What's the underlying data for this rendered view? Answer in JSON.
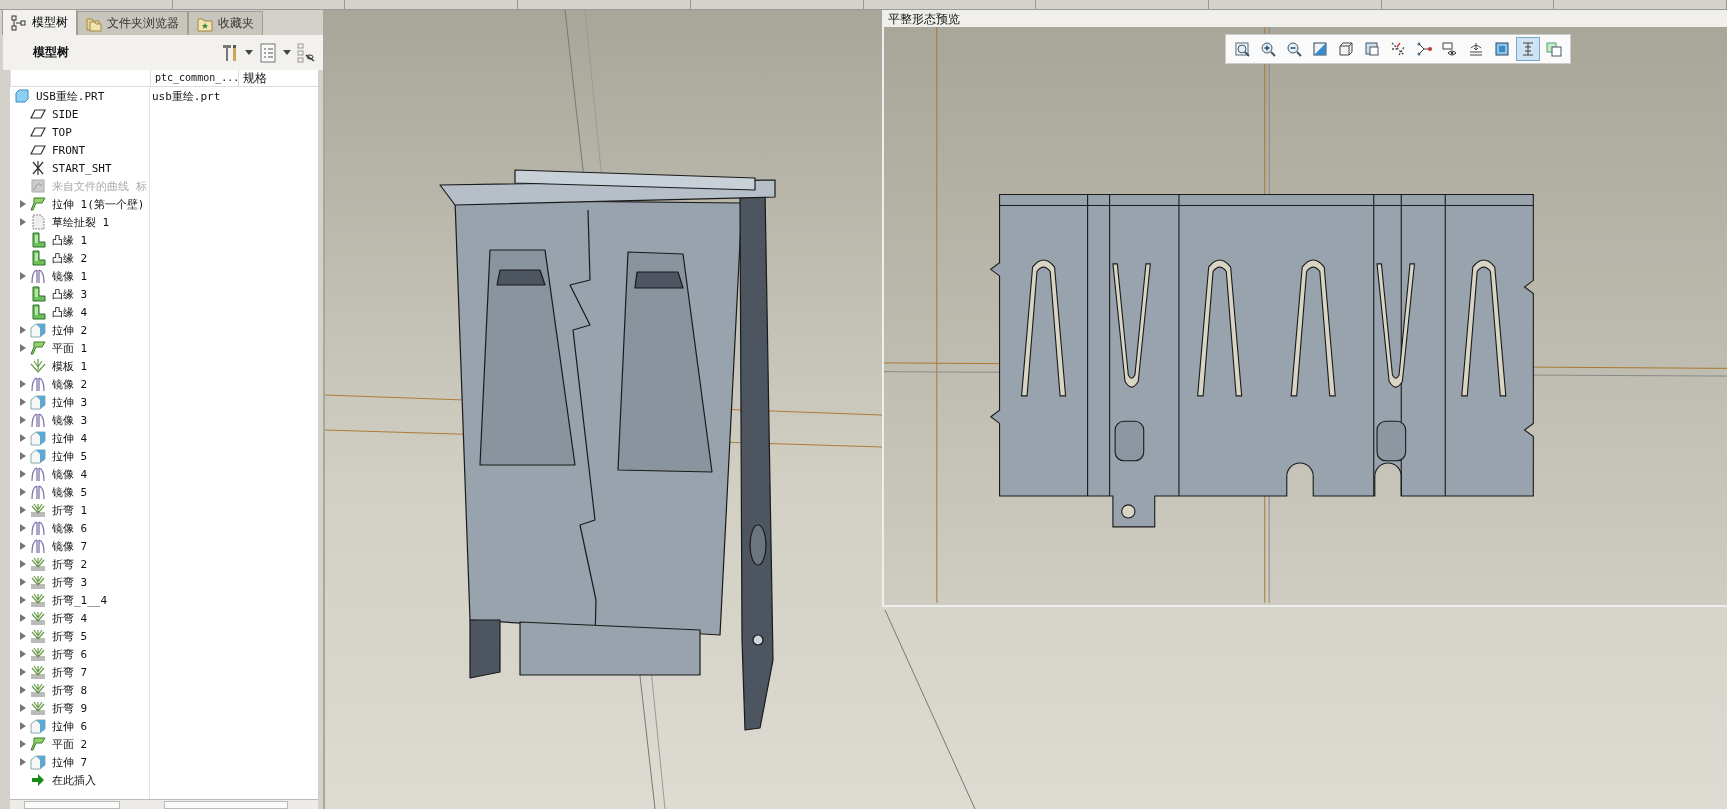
{
  "panel_tabs": [
    {
      "label": "模型树",
      "selected": true
    },
    {
      "label": "文件夹浏览器",
      "selected": false
    },
    {
      "label": "收藏夹",
      "selected": false
    }
  ],
  "model_tree": {
    "title": "模型树",
    "columns": [
      "ptc_common_...",
      "规格"
    ],
    "root": {
      "label": "USB重绘.PRT",
      "cells": [
        "usb重绘.prt"
      ],
      "children": [
        {
          "label": "SIDE",
          "kind": "plane",
          "expander": false,
          "disabled": false
        },
        {
          "label": "TOP",
          "kind": "plane",
          "expander": false,
          "disabled": false
        },
        {
          "label": "FRONT",
          "kind": "plane",
          "expander": false,
          "disabled": false
        },
        {
          "label": "START_SHT",
          "kind": "csys",
          "expander": false,
          "disabled": false
        },
        {
          "label": "来自文件的曲线 标",
          "kind": "curve",
          "expander": false,
          "disabled": true
        },
        {
          "label": "拉伸 1(第一个壁)",
          "kind": "flat",
          "expander": true,
          "disabled": false
        },
        {
          "label": "草绘扯裂 1",
          "kind": "rip",
          "expander": true,
          "disabled": false
        },
        {
          "label": "凸缘 1",
          "kind": "flange",
          "expander": false,
          "disabled": false
        },
        {
          "label": "凸缘 2",
          "kind": "flange",
          "expander": false,
          "disabled": false
        },
        {
          "label": "镜像 1",
          "kind": "mirror",
          "expander": true,
          "disabled": false
        },
        {
          "label": "凸缘 3",
          "kind": "flange",
          "expander": false,
          "disabled": false
        },
        {
          "label": "凸缘 4",
          "kind": "flange",
          "expander": false,
          "disabled": false
        },
        {
          "label": "拉伸 2",
          "kind": "extrude",
          "expander": true,
          "disabled": false
        },
        {
          "label": "平面 1",
          "kind": "flat",
          "expander": true,
          "disabled": false
        },
        {
          "label": "模板 1",
          "kind": "form",
          "expander": false,
          "disabled": false
        },
        {
          "label": "镜像 2",
          "kind": "mirror",
          "expander": true,
          "disabled": false
        },
        {
          "label": "拉伸 3",
          "kind": "extrude",
          "expander": true,
          "disabled": false
        },
        {
          "label": "镜像 3",
          "kind": "mirror",
          "expander": true,
          "disabled": false
        },
        {
          "label": "拉伸 4",
          "kind": "extrude",
          "expander": true,
          "disabled": false
        },
        {
          "label": "拉伸 5",
          "kind": "extrude",
          "expander": true,
          "disabled": false
        },
        {
          "label": "镜像 4",
          "kind": "mirror",
          "expander": true,
          "disabled": false
        },
        {
          "label": "镜像 5",
          "kind": "mirror",
          "expander": true,
          "disabled": false
        },
        {
          "label": "折弯 1",
          "kind": "bend",
          "expander": true,
          "disabled": false
        },
        {
          "label": "镜像 6",
          "kind": "mirror",
          "expander": true,
          "disabled": false
        },
        {
          "label": "镜像 7",
          "kind": "mirror",
          "expander": true,
          "disabled": false
        },
        {
          "label": "折弯 2",
          "kind": "bend",
          "expander": true,
          "disabled": false
        },
        {
          "label": "折弯 3",
          "kind": "bend",
          "expander": true,
          "disabled": false
        },
        {
          "label": "折弯_1__4",
          "kind": "bend",
          "expander": true,
          "disabled": false
        },
        {
          "label": "折弯 4",
          "kind": "bend",
          "expander": true,
          "disabled": false
        },
        {
          "label": "折弯 5",
          "kind": "bend",
          "expander": true,
          "disabled": false
        },
        {
          "label": "折弯 6",
          "kind": "bend",
          "expander": true,
          "disabled": false
        },
        {
          "label": "折弯 7",
          "kind": "bend",
          "expander": true,
          "disabled": false
        },
        {
          "label": "折弯 8",
          "kind": "bend",
          "expander": true,
          "disabled": false
        },
        {
          "label": "折弯 9",
          "kind": "bend",
          "expander": true,
          "disabled": false
        },
        {
          "label": "拉伸 6",
          "kind": "extrude",
          "expander": true,
          "disabled": false
        },
        {
          "label": "平面 2",
          "kind": "flat",
          "expander": true,
          "disabled": false
        },
        {
          "label": "拉伸 7",
          "kind": "extrude",
          "expander": true,
          "disabled": false
        },
        {
          "label": "在此插入",
          "kind": "insert",
          "expander": false,
          "disabled": false
        }
      ]
    }
  },
  "preview": {
    "title": "平整形态预览",
    "toolbar": [
      {
        "selected": false
      },
      {
        "selected": false
      },
      {
        "selected": false
      },
      {
        "selected": false
      },
      {
        "selected": false
      },
      {
        "selected": false
      },
      {
        "selected": false
      },
      {
        "selected": false
      },
      {
        "selected": false
      },
      {
        "selected": false
      },
      {
        "selected": false
      },
      {
        "selected": true
      },
      {
        "selected": false
      }
    ]
  }
}
